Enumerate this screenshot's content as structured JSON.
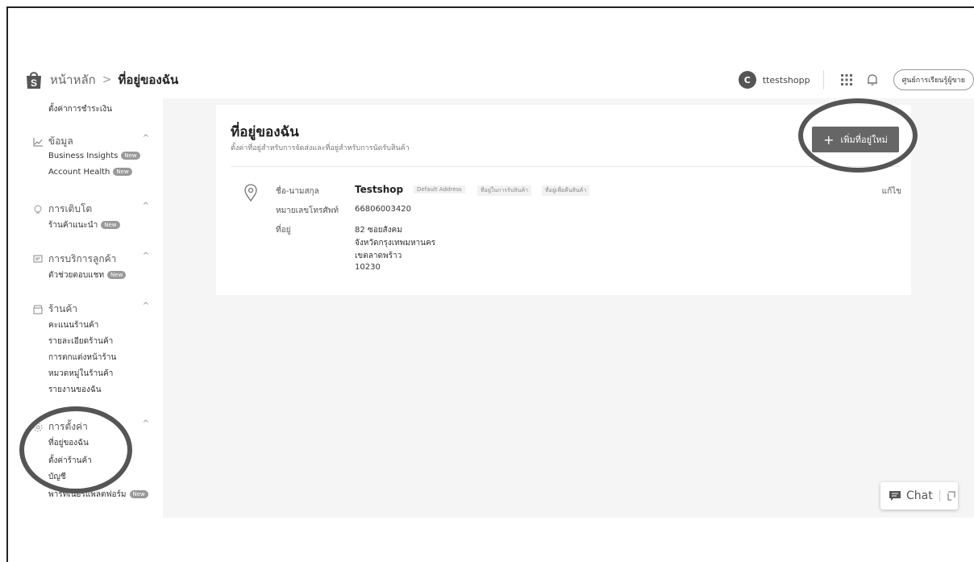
{
  "header": {
    "breadcrumb_home": "หน้าหลัก",
    "breadcrumb_sep": ">",
    "breadcrumb_current": "ที่อยู่ของฉัน",
    "avatar_letter": "C",
    "username": "ttestshopp",
    "seller_center_button": "ศูนย์การเรียนรู้ผู้ขาย",
    "icons": [
      "shop-logo-icon",
      "apps-grid-icon",
      "bell-icon"
    ]
  },
  "sidebar": {
    "payment_settings": "ตั้งค่าการชำระเงิน",
    "data": {
      "label": "ข้อมูล",
      "items": [
        "Business Insights",
        "Account Health"
      ]
    },
    "growth": {
      "label": "การเติบโต",
      "items": [
        "ร้านค้าแนะนำ"
      ]
    },
    "customer_service": {
      "label": "การบริการลูกค้า",
      "items": [
        "ตัวช่วยตอบแชท"
      ]
    },
    "shop": {
      "label": "ร้านค้า",
      "items": [
        "คะแนนร้านค้า",
        "รายละเอียดร้านค้า",
        "การตกแต่งหน้าร้าน",
        "หมวดหมู่ในร้านค้า",
        "รายงานของฉัน"
      ]
    },
    "settings": {
      "label": "การตั้งค่า",
      "items": [
        "ที่อยู่ของฉัน",
        "ตั้งค่าร้านค้า",
        "บัญชี",
        "พาร์ทเนอร์แพลตฟอร์ม"
      ]
    },
    "new_badge": "New"
  },
  "main": {
    "title": "ที่อยู่ของฉัน",
    "subtitle": "ตั้งค่าที่อยู่สำหรับการจัดส่งและที่อยู่สำหรับการนัดรับสินค้า",
    "add_button": "เพิ่มที่อยู่ใหม่",
    "address": {
      "name_label": "ชื่อ-นามสกุล",
      "name": "Testshop",
      "tag_default": "Default Address",
      "tag_pickup": "ที่อยู่ในการรับสินค้า",
      "tag_return": "ที่อยู่เพื่อคืนสินค้า",
      "phone_label": "หมายเลขโทรศัพท์",
      "phone": "66806003420",
      "address_label": "ที่อยู่",
      "line1": "82 ซอยสังคม",
      "line2": "จังหวัดกรุงเทพมหานคร",
      "line3": "เขตลาดพร้าว",
      "line4": "10230",
      "edit": "แก้ไข"
    }
  },
  "chat": {
    "label": "Chat"
  },
  "colors": {
    "annotation": "#555555",
    "button": "#666666",
    "background": "#f5f5f5"
  }
}
